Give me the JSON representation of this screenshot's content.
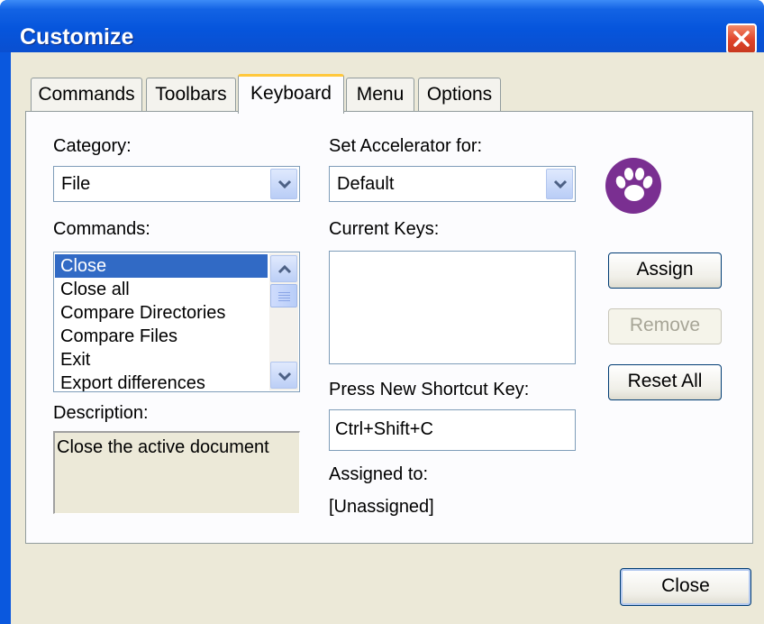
{
  "window": {
    "title": "Customize"
  },
  "tabs": [
    {
      "label": "Commands"
    },
    {
      "label": "Toolbars"
    },
    {
      "label": "Keyboard"
    },
    {
      "label": "Menu"
    },
    {
      "label": "Options"
    }
  ],
  "active_tab": "Keyboard",
  "category": {
    "label": "Category:",
    "value": "File"
  },
  "accelerator": {
    "label": "Set Accelerator for:",
    "value": "Default"
  },
  "commands": {
    "label": "Commands:",
    "items": [
      "Close",
      "Close all",
      "Compare Directories",
      "Compare Files",
      "Exit",
      "Export differences"
    ],
    "selected": "Close"
  },
  "current_keys": {
    "label": "Current Keys:"
  },
  "description": {
    "label": "Description:",
    "text": "Close the active document"
  },
  "shortcut": {
    "label": "Press New Shortcut Key:",
    "value": "Ctrl+Shift+C"
  },
  "assigned": {
    "label": "Assigned to:",
    "value": "[Unassigned]"
  },
  "buttons": {
    "assign": "Assign",
    "remove": "Remove",
    "reset_all": "Reset All",
    "close": "Close"
  },
  "icons": {
    "logo": "paw-print-icon",
    "close": "close-icon"
  },
  "colors": {
    "logo": "#7a2f91",
    "selection": "#316ac5",
    "titlebar": "#0655dc",
    "active_tab_accent": "#ffc83c"
  }
}
